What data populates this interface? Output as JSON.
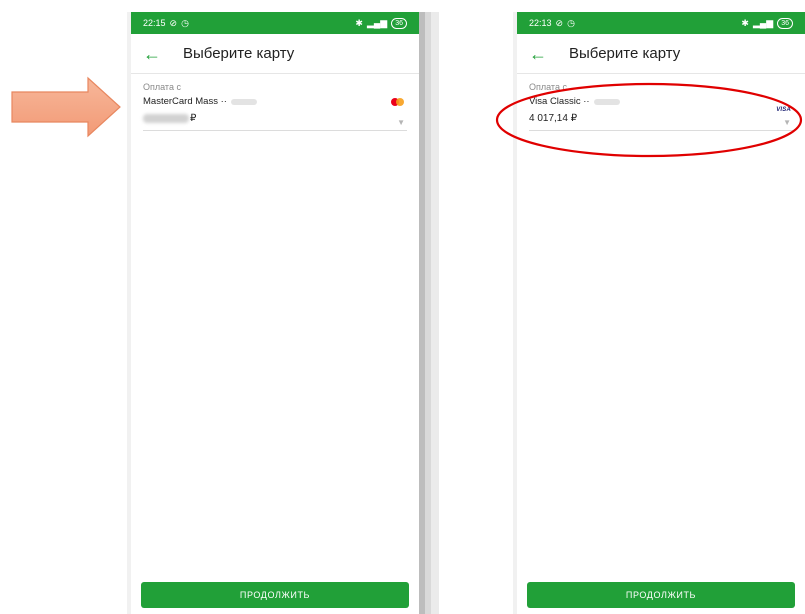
{
  "left_phone": {
    "status_time": "22:15",
    "battery_label": "36",
    "title": "Выберите карту",
    "section_label": "Оплата с",
    "card_name": "MasterCard Mass ··",
    "currency": "₽",
    "continue_label": "ПРОДОЛЖИТЬ",
    "brand_icon": "mastercard-icon"
  },
  "right_phone": {
    "status_time": "22:13",
    "battery_label": "36",
    "title": "Выберите карту",
    "section_label": "Оплата с",
    "card_name": "Visa Classic ··",
    "balance": "4 017,14 ₽",
    "visa_text": "VISA",
    "continue_label": "ПРОДОЛЖИТЬ",
    "brand_icon": "visa-icon"
  },
  "annotations": {
    "arrow_color": "#f4a582",
    "ellipse_color": "#e00000"
  },
  "colors": {
    "brand_green": "#21a038"
  }
}
